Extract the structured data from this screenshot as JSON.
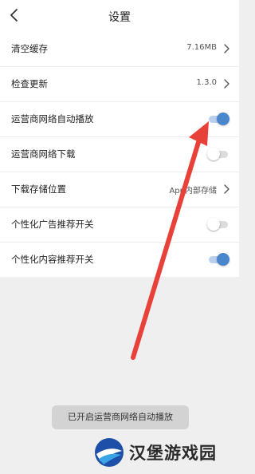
{
  "header": {
    "title": "设置"
  },
  "settings": [
    {
      "label": "清空缓存",
      "value": "7.16MB",
      "control": "chevron"
    },
    {
      "label": "检查更新",
      "value": "1.3.0",
      "control": "chevron"
    },
    {
      "label": "运营商网络自动播放",
      "control": "toggle",
      "on": true
    },
    {
      "label": "运营商网络下载",
      "control": "toggle",
      "on": false
    },
    {
      "label": "下载存储位置",
      "value": "App内部存储",
      "control": "chevron"
    },
    {
      "label": "个性化广告推荐开关",
      "control": "toggle",
      "on": false
    },
    {
      "label": "个性化内容推荐开关",
      "control": "toggle",
      "on": true
    }
  ],
  "toast": {
    "text": "已开启运营商网络自动播放"
  },
  "watermark": {
    "text": "汉堡游戏园"
  },
  "colors": {
    "toggle_on": "#4a86cc",
    "toggle_on_track": "#b8d0ee",
    "toggle_off_track": "#dcdcdc",
    "annotation_arrow": "#e8413a",
    "background": "#efefef"
  }
}
